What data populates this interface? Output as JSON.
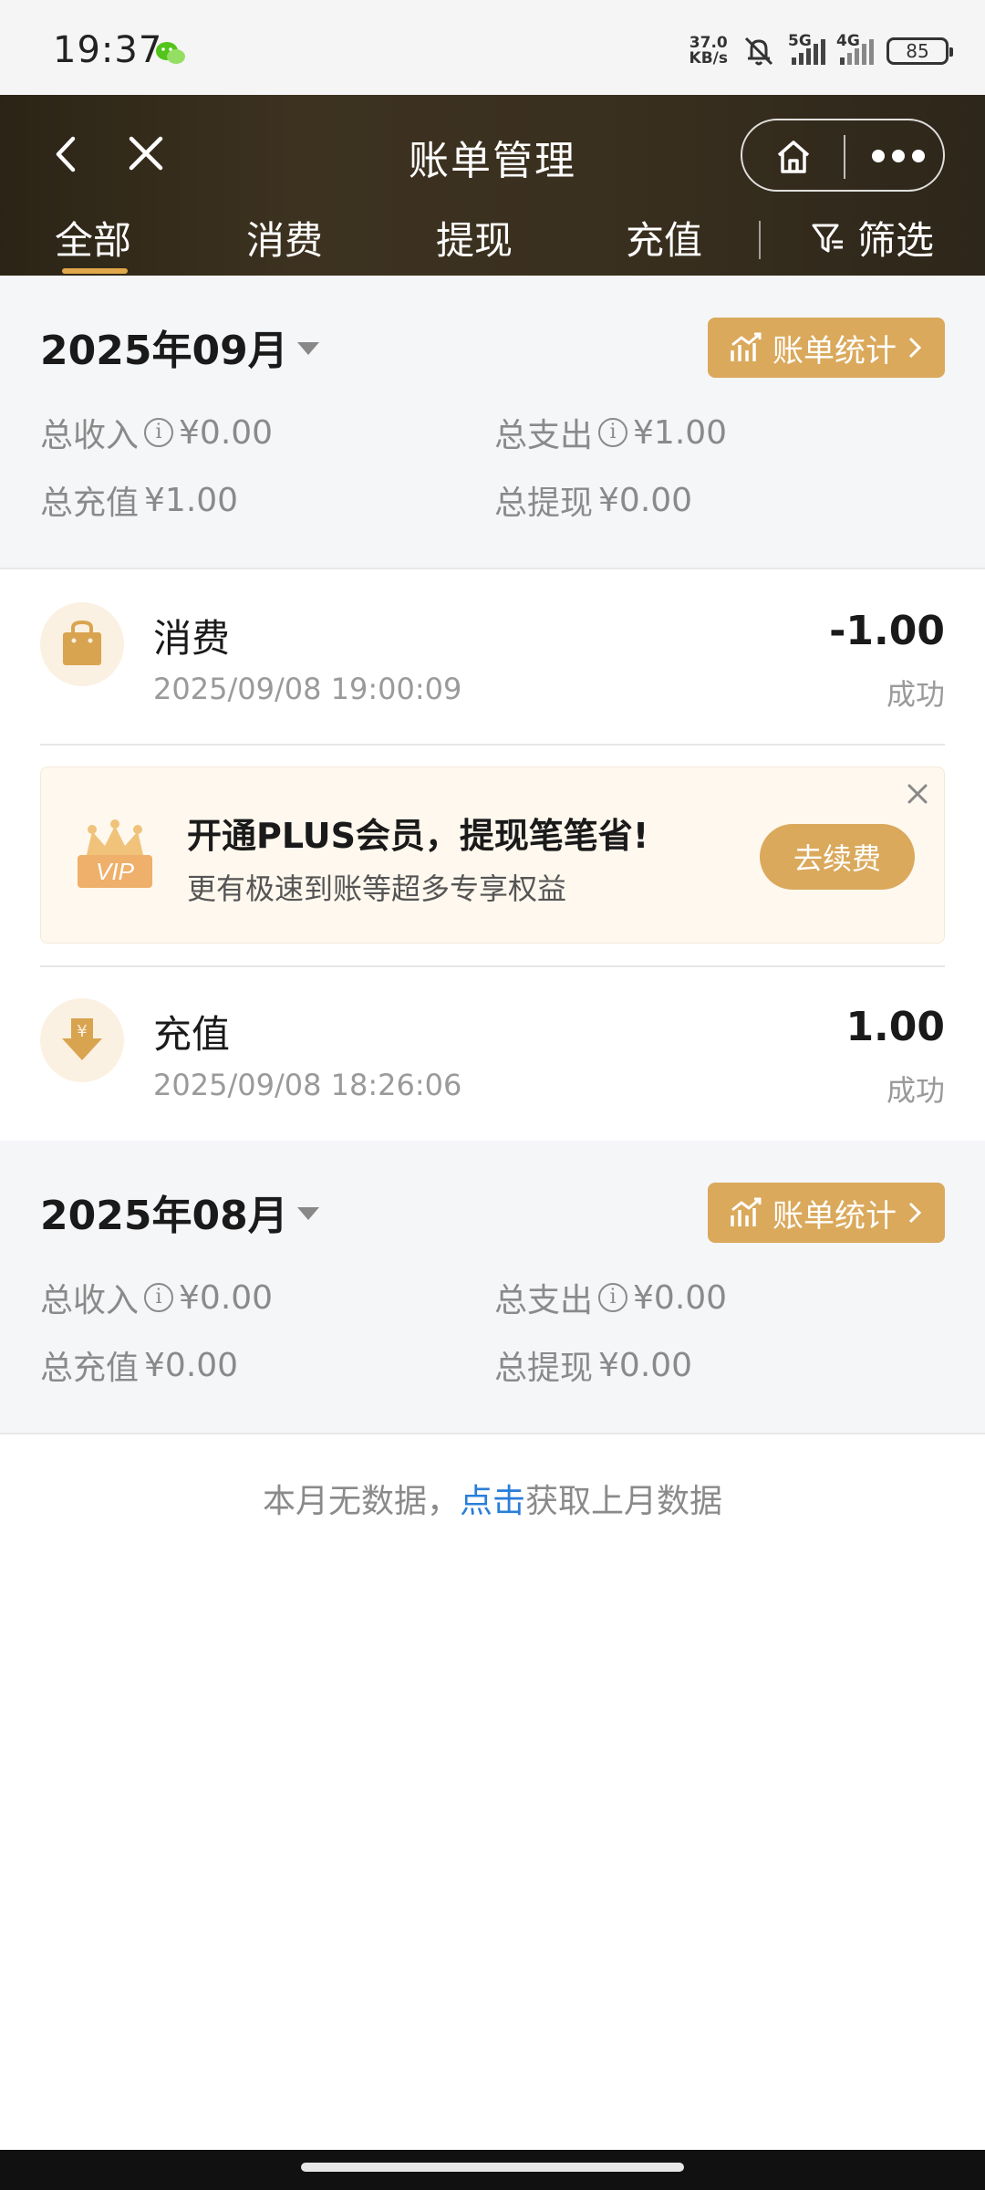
{
  "status_bar": {
    "time": "19:37",
    "net_speed_value": "37.0",
    "net_speed_unit": "KB/s",
    "signal1_label": "5G",
    "signal2_label": "4G",
    "battery": "85"
  },
  "header": {
    "title": "账单管理",
    "tabs": [
      {
        "label": "全部",
        "active": true
      },
      {
        "label": "消费",
        "active": false
      },
      {
        "label": "提现",
        "active": false
      },
      {
        "label": "充值",
        "active": false
      }
    ],
    "filter_label": "筛选",
    "accent_color": "#e0a84a"
  },
  "months": [
    {
      "title": "2025年09月",
      "stats_button": "账单统计",
      "total_income_label": "总收入",
      "total_income": "¥0.00",
      "total_expense_label": "总支出",
      "total_expense": "¥1.00",
      "total_recharge_label": "总充值",
      "total_recharge": "¥1.00",
      "total_withdraw_label": "总提现",
      "total_withdraw": "¥0.00"
    },
    {
      "title": "2025年08月",
      "stats_button": "账单统计",
      "total_income_label": "总收入",
      "total_income": "¥0.00",
      "total_expense_label": "总支出",
      "total_expense": "¥0.00",
      "total_recharge_label": "总充值",
      "total_recharge": "¥0.00",
      "total_withdraw_label": "总提现",
      "total_withdraw": "¥0.00"
    }
  ],
  "transactions": [
    {
      "title": "消费",
      "time": "2025/09/08 19:00:09",
      "amount": "-1.00",
      "status": "成功",
      "icon": "shopping-bag-icon"
    },
    {
      "title": "充值",
      "time": "2025/09/08 18:26:06",
      "amount": "1.00",
      "status": "成功",
      "icon": "recharge-yen-icon"
    }
  ],
  "promo": {
    "badge_text": "VIP",
    "title": "开通PLUS会员，提现笔笔省!",
    "subtitle": "更有极速到账等超多专享权益",
    "button": "去续费"
  },
  "empty": {
    "prefix": "本月无数据，",
    "link": "点击",
    "suffix": "获取上月数据"
  }
}
